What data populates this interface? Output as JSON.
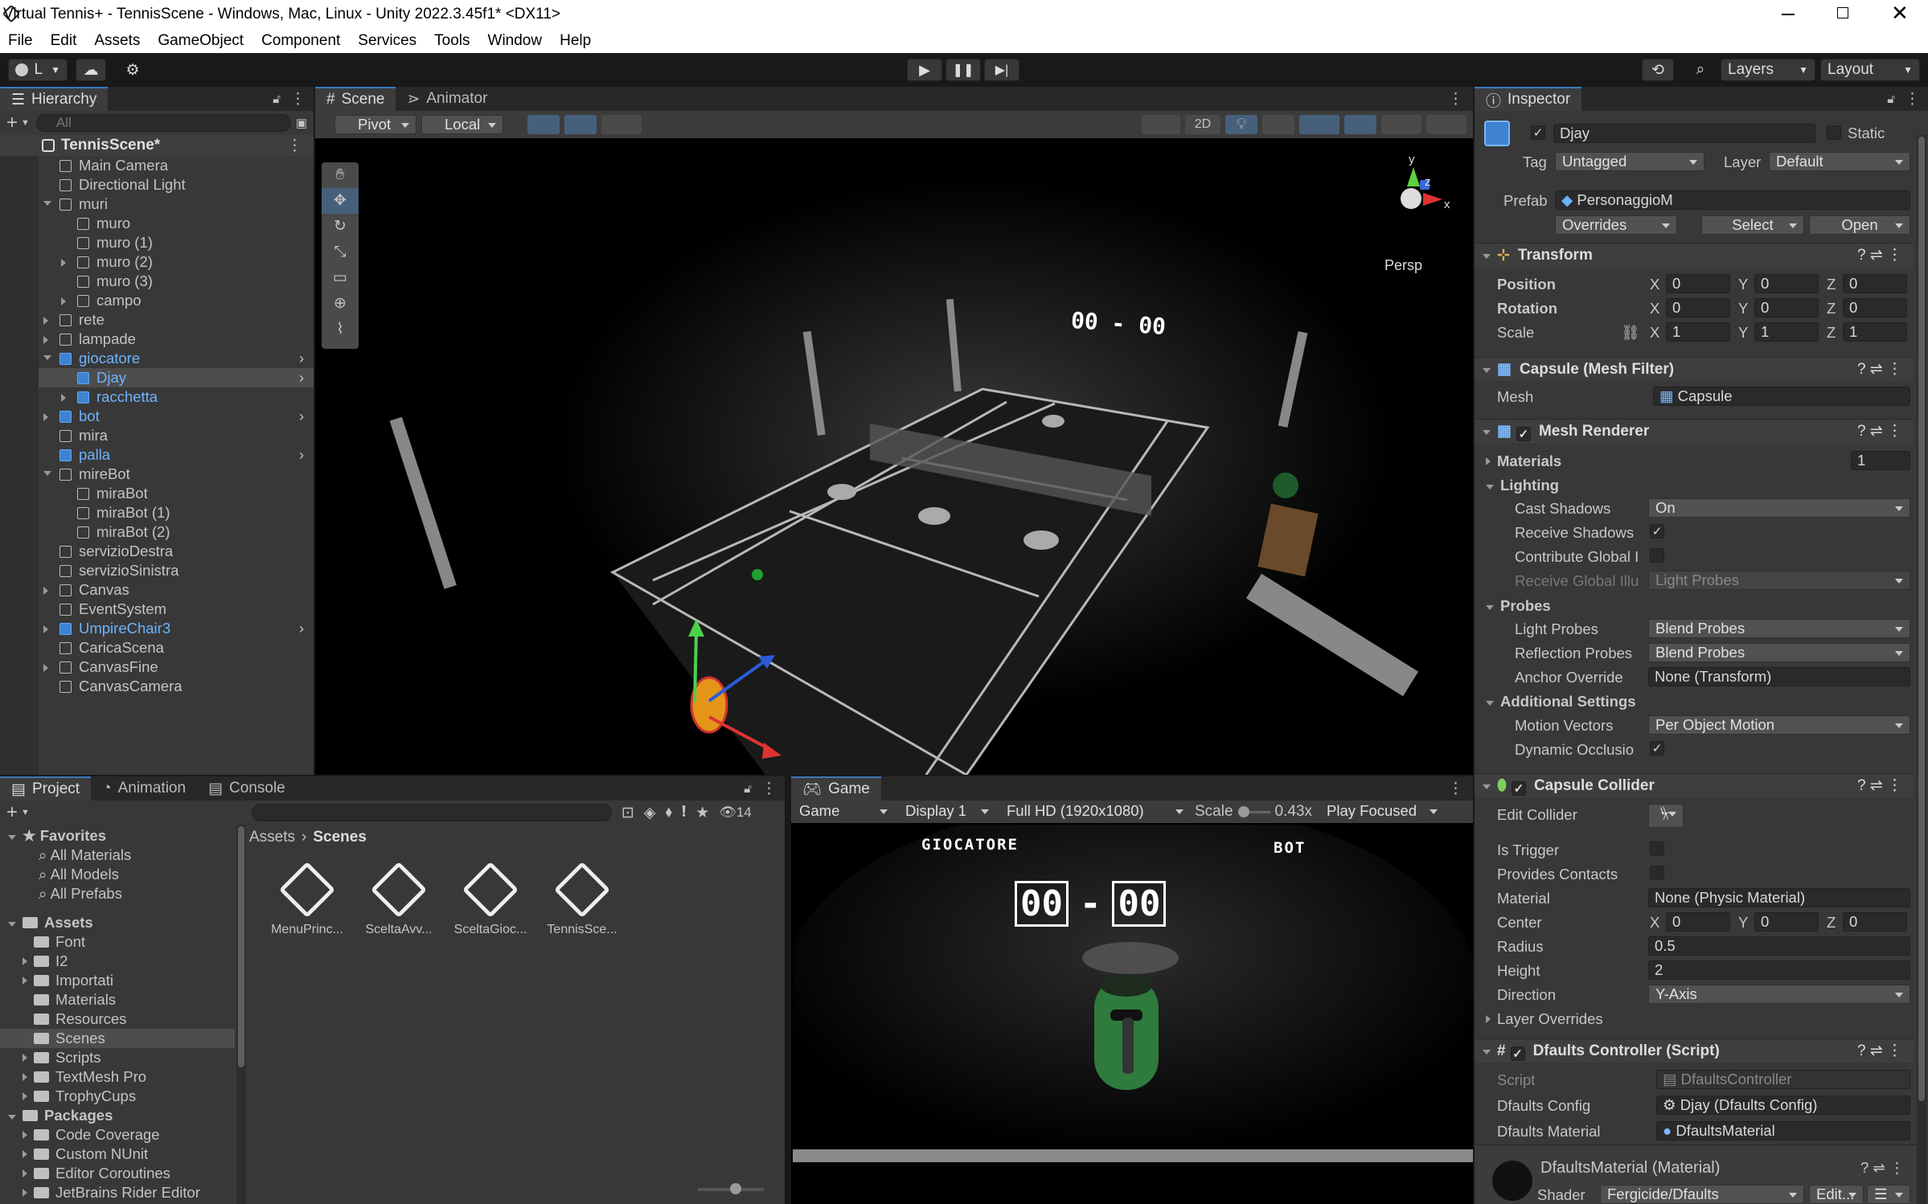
{
  "window": {
    "title": "Virtual Tennis+ - TennisScene - Windows, Mac, Linux - Unity 2022.3.45f1* <DX11>"
  },
  "menu": [
    "File",
    "Edit",
    "Assets",
    "GameObject",
    "Component",
    "Services",
    "Tools",
    "Window",
    "Help"
  ],
  "toolbar": {
    "account": "L",
    "layers": "Layers",
    "layout": "Layout"
  },
  "hierarchy": {
    "tab": "Hierarchy",
    "search_placeholder": "All",
    "scene": "TennisScene*",
    "items": [
      {
        "label": "Main Camera",
        "d": 1,
        "blue": false,
        "exp": ""
      },
      {
        "label": "Directional Light",
        "d": 1,
        "blue": false,
        "exp": ""
      },
      {
        "label": "muri",
        "d": 1,
        "blue": false,
        "exp": "open"
      },
      {
        "label": "muro",
        "d": 2,
        "blue": false,
        "exp": ""
      },
      {
        "label": "muro (1)",
        "d": 2,
        "blue": false,
        "exp": ""
      },
      {
        "label": "muro (2)",
        "d": 2,
        "blue": false,
        "exp": "closed"
      },
      {
        "label": "muro (3)",
        "d": 2,
        "blue": false,
        "exp": ""
      },
      {
        "label": "campo",
        "d": 2,
        "blue": false,
        "exp": "closed"
      },
      {
        "label": "rete",
        "d": 1,
        "blue": false,
        "exp": "closed"
      },
      {
        "label": "lampade",
        "d": 1,
        "blue": false,
        "exp": "closed"
      },
      {
        "label": "giocatore",
        "d": 1,
        "blue": true,
        "exp": "open",
        "more": true
      },
      {
        "label": "Djay",
        "d": 2,
        "blue": true,
        "exp": "",
        "more": true,
        "sel": true
      },
      {
        "label": "racchetta",
        "d": 2,
        "blue": true,
        "exp": "closed"
      },
      {
        "label": "bot",
        "d": 1,
        "blue": true,
        "exp": "closed",
        "more": true
      },
      {
        "label": "mira",
        "d": 1,
        "blue": false,
        "exp": ""
      },
      {
        "label": "palla",
        "d": 1,
        "blue": true,
        "exp": "",
        "more": true
      },
      {
        "label": "mireBot",
        "d": 1,
        "blue": false,
        "exp": "open"
      },
      {
        "label": "miraBot",
        "d": 2,
        "blue": false,
        "exp": ""
      },
      {
        "label": "miraBot (1)",
        "d": 2,
        "blue": false,
        "exp": ""
      },
      {
        "label": "miraBot (2)",
        "d": 2,
        "blue": false,
        "exp": ""
      },
      {
        "label": "servizioDestra",
        "d": 1,
        "blue": false,
        "exp": ""
      },
      {
        "label": "servizioSinistra",
        "d": 1,
        "blue": false,
        "exp": ""
      },
      {
        "label": "Canvas",
        "d": 1,
        "blue": false,
        "exp": "closed"
      },
      {
        "label": "EventSystem",
        "d": 1,
        "blue": false,
        "exp": ""
      },
      {
        "label": "UmpireChair3",
        "d": 1,
        "blue": true,
        "exp": "closed",
        "more": true
      },
      {
        "label": "CaricaScena",
        "d": 1,
        "blue": false,
        "exp": ""
      },
      {
        "label": "CanvasFine",
        "d": 1,
        "blue": false,
        "exp": "closed"
      },
      {
        "label": "CanvasCamera",
        "d": 1,
        "blue": false,
        "exp": ""
      }
    ]
  },
  "scene": {
    "tabs": [
      "Scene",
      "Animator"
    ],
    "pivot": "Pivot",
    "local": "Local",
    "mode2d": "2D",
    "persp": "Persp",
    "score": "00 - 00"
  },
  "project": {
    "tabs": [
      "Project",
      "Animation",
      "Console"
    ],
    "count": "14",
    "breadcrumb": [
      "Assets",
      "Scenes"
    ],
    "favorites_label": "Favorites",
    "favorites": [
      "All Materials",
      "All Models",
      "All Prefabs"
    ],
    "assets_label": "Assets",
    "assets": [
      "Font",
      "I2",
      "Importati",
      "Materials",
      "Resources",
      "Scenes",
      "Scripts",
      "TextMesh Pro",
      "TrophyCups"
    ],
    "packages_label": "Packages",
    "packages": [
      "Code Coverage",
      "Custom NUnit",
      "Editor Coroutines",
      "JetBrains Rider Editor"
    ],
    "files": [
      "MenuPrinc...",
      "SceltaAvv...",
      "SceltaGioc...",
      "TennisSce..."
    ]
  },
  "game": {
    "tab": "Game",
    "view": "Game",
    "display": "Display 1",
    "resolution": "Full HD (1920x1080)",
    "scale_label": "Scale",
    "scale_value": "0.43x",
    "play_mode": "Play Focused",
    "player_label": "GIOCATORE",
    "bot_label": "BOT",
    "score_left": "00",
    "score_dash": "-",
    "score_right": "00"
  },
  "inspector": {
    "tab": "Inspector",
    "name": "Djay",
    "static": "Static",
    "tag_label": "Tag",
    "tag": "Untagged",
    "layer_label": "Layer",
    "layer": "Default",
    "prefab_label": "Prefab",
    "prefab": "PersonaggioM",
    "overrides": "Overrides",
    "select": "Select",
    "open": "Open",
    "transform": {
      "title": "Transform",
      "position": "Position",
      "rotation": "Rotation",
      "scale": "Scale",
      "pos": [
        "0",
        "0",
        "0"
      ],
      "rot": [
        "0",
        "0",
        "0"
      ],
      "scl": [
        "1",
        "1",
        "1"
      ]
    },
    "meshfilter": {
      "title": "Capsule (Mesh Filter)",
      "mesh_label": "Mesh",
      "mesh": "Capsule"
    },
    "meshrenderer": {
      "title": "Mesh Renderer",
      "materials": "Materials",
      "materials_count": "1",
      "lighting": "Lighting",
      "cast_shadows": "Cast Shadows",
      "cast_value": "On",
      "receive_shadows": "Receive Shadows",
      "contribute_gi": "Contribute Global I",
      "receive_gi": "Receive Global Illu",
      "receive_gi_value": "Light Probes",
      "probes": "Probes",
      "light_probes": "Light Probes",
      "light_probes_value": "Blend Probes",
      "reflection_probes": "Reflection Probes",
      "reflection_value": "Blend Probes",
      "anchor": "Anchor Override",
      "anchor_value": "None (Transform)",
      "additional": "Additional Settings",
      "motion_vectors": "Motion Vectors",
      "motion_value": "Per Object Motion",
      "dynamic_occ": "Dynamic Occlusio"
    },
    "collider": {
      "title": "Capsule Collider",
      "edit": "Edit Collider",
      "is_trigger": "Is Trigger",
      "provides": "Provides Contacts",
      "material": "Material",
      "material_value": "None (Physic Material)",
      "center": "Center",
      "center_v": [
        "0",
        "0",
        "0"
      ],
      "radius": "Radius",
      "radius_v": "0.5",
      "height": "Height",
      "height_v": "2",
      "direction": "Direction",
      "direction_v": "Y-Axis",
      "layer_overrides": "Layer Overrides"
    },
    "script": {
      "title": "Dfaults Controller (Script)",
      "script_label": "Script",
      "script_value": "DfaultsController",
      "config_label": "Dfaults Config",
      "config_value": "Djay (Dfaults Config)",
      "material_label": "Dfaults Material",
      "material_value": "DfaultsMaterial"
    },
    "material": {
      "title": "DfaultsMaterial (Material)",
      "shader_label": "Shader",
      "shader_value": "Fergicide/Dfaults",
      "edit": "Edit..."
    }
  }
}
